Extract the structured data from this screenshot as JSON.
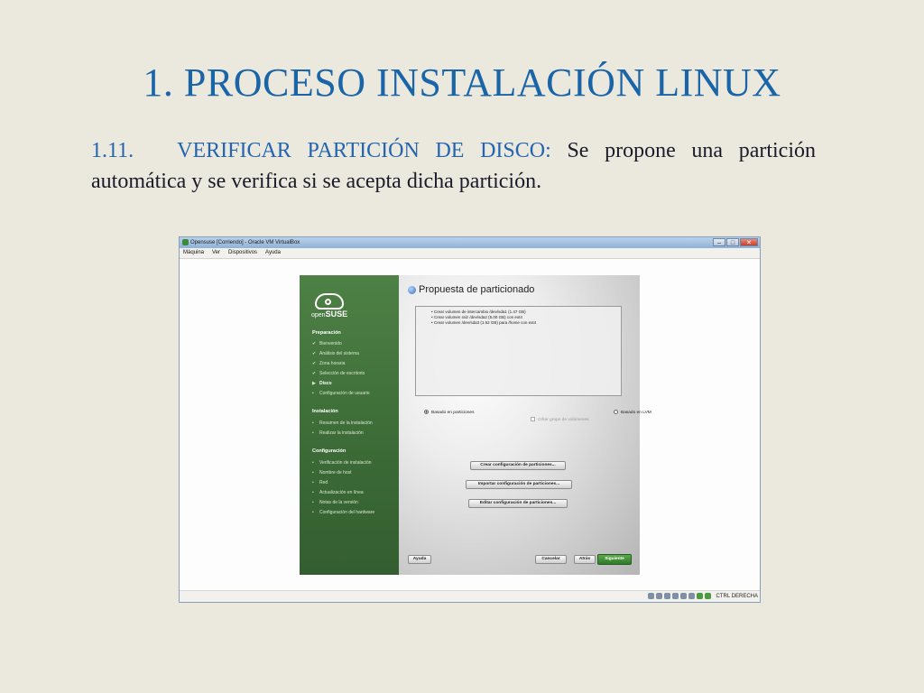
{
  "slide": {
    "title": "1. PROCESO INSTALACIÓN LINUX",
    "section_number": "1.11.",
    "section_heading": "VERIFICAR PARTICIÓN DE DISCO:",
    "description": "Se propone una partición automática y se verifica si se acepta dicha partición."
  },
  "vbox": {
    "window_title": "Opensuse [Corriendo] - Oracle VM VirtualBox",
    "window_controls": {
      "minimize": "–",
      "maximize": "□",
      "close": "✕"
    },
    "menu": [
      "Máquina",
      "Ver",
      "Dispositivos",
      "Ayuda"
    ],
    "host_key": "CTRL DERECHA",
    "status_icons": [
      "hard-disk-icon",
      "optical-drive-icon",
      "usb-icon",
      "shared-folders-icon",
      "network-icon",
      "capture-icon",
      "mouse-integration-icon",
      "host-key-icon"
    ]
  },
  "installer": {
    "logo_light": "open",
    "logo_bold": "SUSE",
    "sections": [
      {
        "title": "Preparación",
        "items": [
          {
            "label": "Bienvenido",
            "state": "done"
          },
          {
            "label": "Análisis del sistema",
            "state": "done"
          },
          {
            "label": "Zona horaria",
            "state": "done"
          },
          {
            "label": "Selección de escritorio",
            "state": "done"
          },
          {
            "label": "Disco",
            "state": "current"
          },
          {
            "label": "Configuración de usuario",
            "state": "pending"
          }
        ]
      },
      {
        "title": "Instalación",
        "items": [
          {
            "label": "Resumen de la instalación",
            "state": "pending"
          },
          {
            "label": "Realizar la instalación",
            "state": "pending"
          }
        ]
      },
      {
        "title": "Configuración",
        "items": [
          {
            "label": "Verificación de instalación",
            "state": "pending"
          },
          {
            "label": "Nombre de host",
            "state": "pending"
          },
          {
            "label": "Red",
            "state": "pending"
          },
          {
            "label": "Actualización en línea",
            "state": "pending"
          },
          {
            "label": "Notas de la versión",
            "state": "pending"
          },
          {
            "label": "Configuración del hardware",
            "state": "pending"
          }
        ]
      }
    ],
    "page_title": "Propuesta de particionado",
    "proposal_lines": [
      "Crear volumen de intercambio /dev/sda1 (1.47 GB)",
      "Crear volumen raíz /dev/sda2 (5.00 GB) con ext4",
      "Crear volumen /dev/sda3 (1.52 GB) para /home con ext4"
    ],
    "radio_partitions": "Basado en particiones",
    "radio_lvm": "Basado en LVM",
    "checkbox_encrypt": "Cifrar grupo de volúmenes",
    "radio_selected": "partitions",
    "buttons": {
      "create": "Crear configuración de particiones...",
      "import": "Importar configuración de particiones...",
      "edit": "Editar configuración de particiones...",
      "help": "Ayuda",
      "cancel": "Cancelar",
      "back": "Atrás",
      "next": "Siguiente"
    }
  }
}
